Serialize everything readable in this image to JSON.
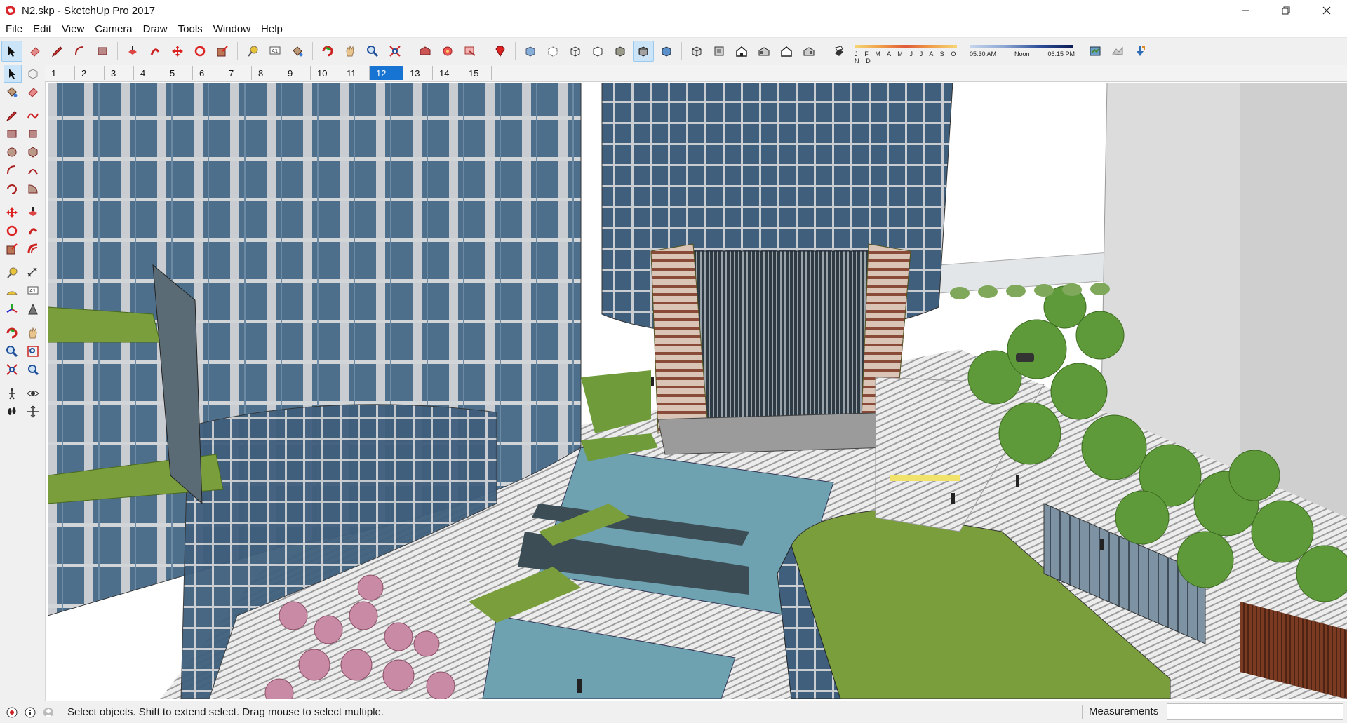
{
  "window": {
    "title": "N2.skp - SketchUp Pro 2017",
    "minimize_icon": "minimize-icon",
    "restore_icon": "restore-icon",
    "close_icon": "close-icon"
  },
  "menu": {
    "items": [
      "File",
      "Edit",
      "View",
      "Camera",
      "Draw",
      "Tools",
      "Window",
      "Help"
    ]
  },
  "toolbar": {
    "shadow_months": "J F M A M J J A S O N D",
    "time_start": "05:30 AM",
    "time_mid": "Noon",
    "time_end": "06:15 PM"
  },
  "scenes": {
    "tabs": [
      "1",
      "2",
      "3",
      "4",
      "5",
      "6",
      "7",
      "8",
      "9",
      "10",
      "11",
      "12",
      "13",
      "14",
      "15"
    ],
    "active": "12"
  },
  "status": {
    "message": "Select objects. Shift to extend select. Drag mouse to select multiple.",
    "measurements_label": "Measurements",
    "measurements_value": ""
  },
  "colors": {
    "glass": "#4d6f8c",
    "mullion": "#c9ccd0",
    "green_roof": "#7a9e3c",
    "tree": "#5f9a3a",
    "water": "#6ea2b0",
    "active_tab": "#1874d2"
  }
}
